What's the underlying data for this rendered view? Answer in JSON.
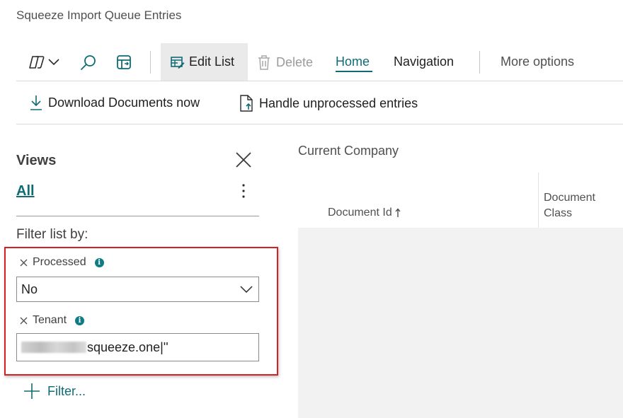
{
  "page": {
    "title": "Squeeze Import Queue Entries"
  },
  "toolbar": {
    "edit_list": "Edit List",
    "delete": "Delete",
    "home": "Home",
    "navigation": "Navigation",
    "more_options": "More options",
    "icons": [
      "copilot-icon",
      "chevron-down-icon",
      "search-icon",
      "share-to-excel-icon",
      "edit-list-icon",
      "trash-icon"
    ]
  },
  "actions": {
    "download": "Download Documents now",
    "handle": "Handle unprocessed entries"
  },
  "views": {
    "title": "Views",
    "current": "All",
    "filter_by": "Filter list by:",
    "filters": [
      {
        "label": "Processed",
        "value": "No"
      },
      {
        "label": "Tenant",
        "value": "squeeze.one|''"
      }
    ],
    "add_filter": "Filter..."
  },
  "list": {
    "company": "Current Company",
    "columns": [
      {
        "label": "Document Id",
        "sort": "ascending"
      },
      {
        "label": "Document\nClass"
      }
    ]
  },
  "colors": {
    "accent": "#0f6b74",
    "highlight_border": "#d42027"
  }
}
